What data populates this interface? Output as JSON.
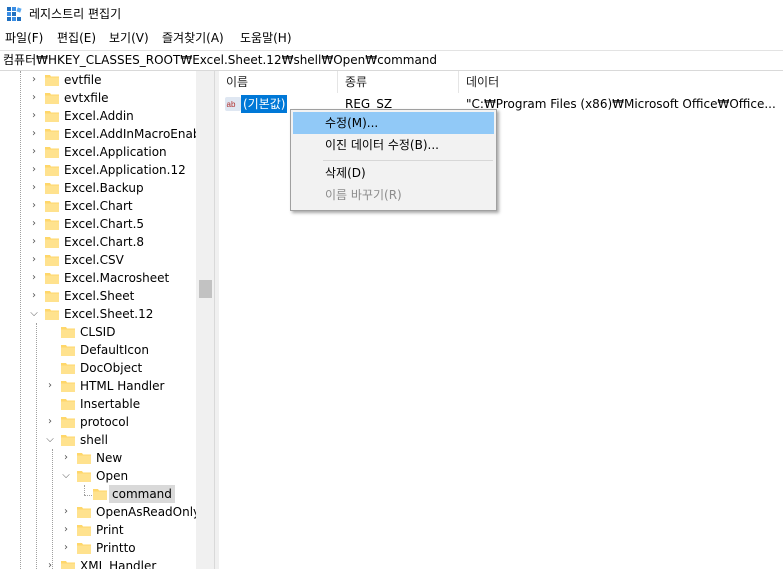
{
  "window": {
    "title": "레지스트리 편집기"
  },
  "menu": [
    "파일(F)",
    "편집(E)",
    "보기(V)",
    "즐겨찾기(A)",
    "도움말(H)"
  ],
  "address": "컴퓨터₩HKEY_CLASSES_ROOT₩Excel.Sheet.12₩shell₩Open₩command",
  "tree": [
    {
      "label": "evtfile"
    },
    {
      "label": "evtxfile"
    },
    {
      "label": "Excel.Addin"
    },
    {
      "label": "Excel.AddInMacroEnabled"
    },
    {
      "label": "Excel.Application"
    },
    {
      "label": "Excel.Application.12"
    },
    {
      "label": "Excel.Backup"
    },
    {
      "label": "Excel.Chart"
    },
    {
      "label": "Excel.Chart.5"
    },
    {
      "label": "Excel.Chart.8"
    },
    {
      "label": "Excel.CSV"
    },
    {
      "label": "Excel.Macrosheet"
    },
    {
      "label": "Excel.Sheet"
    },
    {
      "label": "Excel.Sheet.12"
    },
    {
      "label": "CLSID"
    },
    {
      "label": "DefaultIcon"
    },
    {
      "label": "DocObject"
    },
    {
      "label": "HTML Handler"
    },
    {
      "label": "Insertable"
    },
    {
      "label": "protocol"
    },
    {
      "label": "shell"
    },
    {
      "label": "New"
    },
    {
      "label": "Open"
    },
    {
      "label": "command"
    },
    {
      "label": "OpenAsReadOnly"
    },
    {
      "label": "Print"
    },
    {
      "label": "Printto"
    },
    {
      "label": "XML Handler"
    }
  ],
  "list": {
    "columns": [
      "이름",
      "종류",
      "데이터"
    ],
    "rows": [
      {
        "name": "(기본값)",
        "type": "REG_SZ",
        "data": "\"C:₩Program Files (x86)₩Microsoft Office₩Office..."
      }
    ]
  },
  "context_menu": {
    "items": [
      "수정(M)...",
      "이진 데이터 수정(B)...",
      "삭제(D)",
      "이름 바꾸기(R)"
    ]
  },
  "colors": {
    "selection": "#0078d7",
    "menu_hover": "#91c9f7",
    "folder": "#ffd76a"
  }
}
